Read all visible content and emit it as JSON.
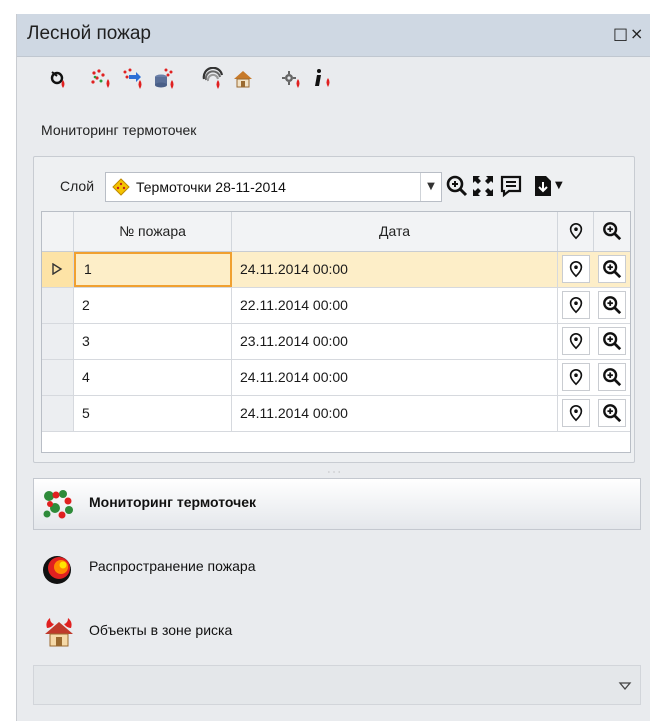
{
  "window": {
    "title": "Лесной пожар",
    "maximize_glyph": "□",
    "close_glyph": "×"
  },
  "toolbar": {
    "icons": [
      "locate-fire-icon",
      "hotspots-icon",
      "hotspots-import-icon",
      "hotspots-db-icon",
      "fire-spread-icon",
      "risk-objects-icon",
      "settings-icon",
      "info-icon"
    ]
  },
  "section": {
    "title": "Мониторинг термоточек"
  },
  "layer": {
    "label": "Слой",
    "value": "Термоточки 28-11-2014"
  },
  "grid": {
    "columns": [
      "№ пожара",
      "Дата"
    ],
    "rows": [
      {
        "num": "1",
        "date": "24.11.2014 00:00",
        "selected": true
      },
      {
        "num": "2",
        "date": "22.11.2014 00:00",
        "selected": false
      },
      {
        "num": "3",
        "date": "23.11.2014 00:00",
        "selected": false
      },
      {
        "num": "4",
        "date": "24.11.2014 00:00",
        "selected": false
      },
      {
        "num": "5",
        "date": "24.11.2014 00:00",
        "selected": false
      }
    ]
  },
  "nav": {
    "items": [
      {
        "label": "Мониторинг термоточек",
        "active": true,
        "icon": "hotspots-icon"
      },
      {
        "label": "Распространение пожара",
        "active": false,
        "icon": "fire-spread-icon"
      },
      {
        "label": "Объекты в зоне риска",
        "active": false,
        "icon": "risk-objects-icon"
      }
    ]
  },
  "colors": {
    "accent": "#f0a030",
    "selection": "#fdeec8",
    "title_bar": "#cfd8e3",
    "fire_red": "#e02020"
  }
}
